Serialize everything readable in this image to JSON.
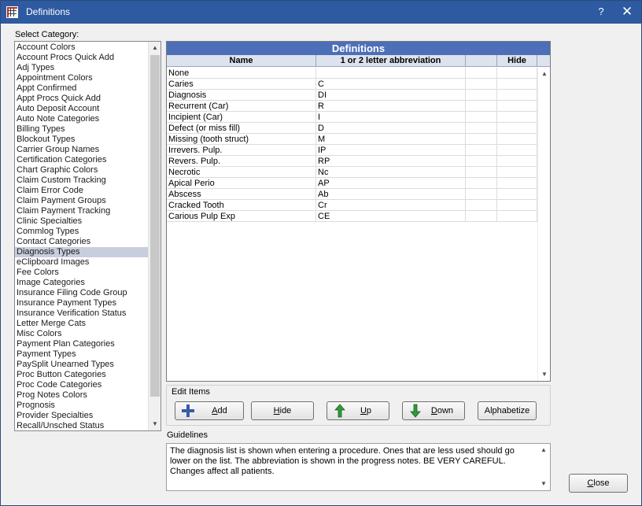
{
  "window": {
    "title": "Definitions",
    "help_label": "?",
    "close_label": "✕"
  },
  "category": {
    "label": "Select Category:",
    "selected_index": 20,
    "items": [
      "Account Colors",
      "Account Procs Quick Add",
      "Adj Types",
      "Appointment Colors",
      "Appt Confirmed",
      "Appt Procs Quick Add",
      "Auto Deposit Account",
      "Auto Note Categories",
      "Billing Types",
      "Blockout Types",
      "Carrier Group Names",
      "Certification Categories",
      "Chart Graphic Colors",
      "Claim Custom Tracking",
      "Claim Error Code",
      "Claim Payment Groups",
      "Claim Payment Tracking",
      "Clinic Specialties",
      "Commlog Types",
      "Contact Categories",
      "Diagnosis Types",
      "eClipboard Images",
      "Fee Colors",
      "Image Categories",
      "Insurance Filing Code Group",
      "Insurance Payment Types",
      "Insurance Verification Status",
      "Letter Merge Cats",
      "Misc Colors",
      "Payment Plan Categories",
      "Payment Types",
      "PaySplit Unearned Types",
      "Proc Button Categories",
      "Proc Code Categories",
      "Prog Notes Colors",
      "Prognosis",
      "Provider Specialties",
      "Recall/Unsched Status"
    ]
  },
  "definitions": {
    "title": "Definitions",
    "columns": {
      "name": "Name",
      "abbr": "1 or 2 letter abbreviation",
      "blank": "",
      "hide": "Hide"
    },
    "rows": [
      {
        "name": "None",
        "abbr": "",
        "hide": ""
      },
      {
        "name": "Caries",
        "abbr": "C",
        "hide": ""
      },
      {
        "name": "Diagnosis",
        "abbr": "DI",
        "hide": ""
      },
      {
        "name": "Recurrent (Car)",
        "abbr": "R",
        "hide": ""
      },
      {
        "name": "Incipient (Car)",
        "abbr": "I",
        "hide": ""
      },
      {
        "name": "Defect (or miss fill)",
        "abbr": "D",
        "hide": ""
      },
      {
        "name": "Missing (tooth struct)",
        "abbr": "M",
        "hide": ""
      },
      {
        "name": "Irrevers. Pulp.",
        "abbr": "IP",
        "hide": ""
      },
      {
        "name": "Revers. Pulp.",
        "abbr": "RP",
        "hide": ""
      },
      {
        "name": "Necrotic",
        "abbr": "Nc",
        "hide": ""
      },
      {
        "name": "Apical Perio",
        "abbr": "AP",
        "hide": ""
      },
      {
        "name": "Abscess",
        "abbr": "Ab",
        "hide": ""
      },
      {
        "name": "Cracked Tooth",
        "abbr": "Cr",
        "hide": ""
      },
      {
        "name": "Carious Pulp Exp",
        "abbr": "CE",
        "hide": ""
      }
    ]
  },
  "edit_items": {
    "label": "Edit Items",
    "add_key": "A",
    "add_rest": "dd",
    "hide_key": "H",
    "hide_rest": "ide",
    "up_key": "U",
    "up_rest": "p",
    "down_key": "D",
    "down_rest": "own",
    "alphabetize": "Alphabetize"
  },
  "guidelines": {
    "label": "Guidelines",
    "text": "The diagnosis list is shown when entering a procedure.  Ones that are less used should go lower on the list.  The abbreviation is shown in the progress notes.  BE VERY CAREFUL.  Changes affect all patients."
  },
  "close_button": {
    "key": "C",
    "rest": "lose"
  },
  "colors": {
    "titlebar": "#2d5aa0",
    "grid_title": "#4d6fb8",
    "selection": "#c9cedd",
    "arrow_green": "#2f9a3a"
  }
}
